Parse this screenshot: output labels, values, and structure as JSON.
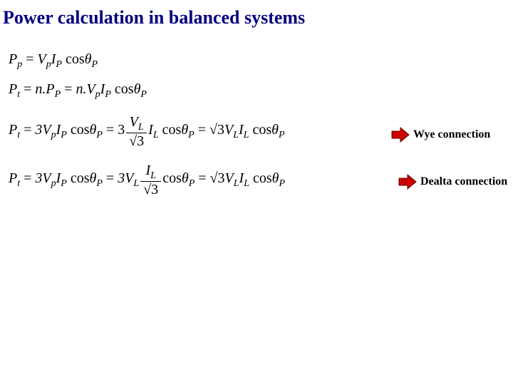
{
  "title": "Power calculation in balanced systems",
  "equations": {
    "l1": {
      "lhs": "P",
      "lhs_sub": "p",
      "rhs_a": "V",
      "rhs_a_sub": "p",
      "rhs_b": "I",
      "rhs_b_sub": "P",
      "cos": "cos",
      "theta": "θ",
      "theta_sub": "P"
    },
    "l2": {
      "lhs": "P",
      "lhs_sub": "t",
      "eq1a": "n.P",
      "eq1a_sub": "P",
      "eq2a": "n.V",
      "eq2a_sub": "p",
      "eq2b": "I",
      "eq2b_sub": "P",
      "cos": "cos",
      "theta": "θ",
      "theta_sub": "P"
    },
    "l3": {
      "lhs": "P",
      "lhs_sub": "t",
      "t1a": "3V",
      "t1a_sub": "p",
      "t1b": "I",
      "t1b_sub": "P",
      "cos": "cos",
      "theta": "θ",
      "theta_sub": "P",
      "t2pre": "3",
      "frac_num": "V",
      "frac_num_sub": "L",
      "frac_den": "√3",
      "t2b": "I",
      "t2b_sub": "L",
      "t3a": "√3",
      "t3b": "V",
      "t3b_sub": "L",
      "t3c": "I",
      "t3c_sub": "L"
    },
    "l4": {
      "lhs": "P",
      "lhs_sub": "t",
      "t1a": "3V",
      "t1a_sub": "p",
      "t1b": "I",
      "t1b_sub": "P",
      "cos": "cos",
      "theta": "θ",
      "theta_sub": "P",
      "t2pre": "3V",
      "t2pre_sub": "L",
      "frac_num": "I",
      "frac_num_sub": "L",
      "frac_den": "√3",
      "t3a": "√3",
      "t3b": "V",
      "t3b_sub": "L",
      "t3c": "I",
      "t3c_sub": "L"
    }
  },
  "labels": {
    "wye": "Wye connection",
    "delta": "Dealta connection"
  },
  "colors": {
    "title": "#000080",
    "arrow_fill": "#cc0000",
    "arrow_outline": "#660000"
  }
}
